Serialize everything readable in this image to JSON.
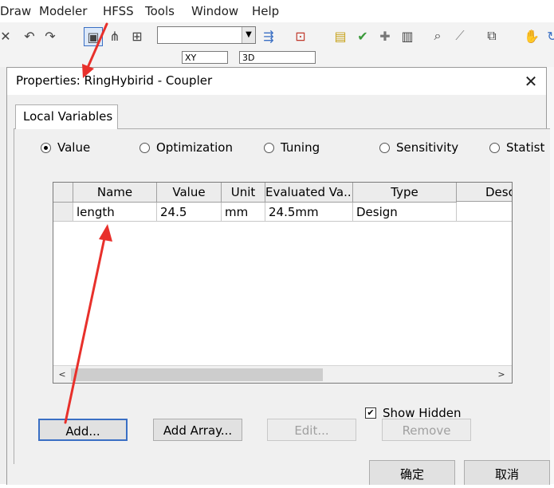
{
  "app": {
    "menu": [
      "Draw",
      "Modeler",
      "HFSS",
      "Tools",
      "Window",
      "Help"
    ],
    "toolbar_combo1": "",
    "toolbar_combo2": "XY",
    "toolbar_combo3": "3D"
  },
  "dialog": {
    "title": "Properties: RingHybirid - Coupler",
    "close": "✕",
    "tab": "Local Variables",
    "radios": [
      {
        "label": "Value",
        "selected": true
      },
      {
        "label": "Optimization",
        "selected": false
      },
      {
        "label": "Tuning",
        "selected": false
      },
      {
        "label": "Sensitivity",
        "selected": false
      },
      {
        "label": "Statist",
        "selected": false
      }
    ],
    "table": {
      "columns": [
        "Name",
        "Value",
        "Unit",
        "Evaluated Va...",
        "Type",
        "Desc"
      ],
      "rows": [
        [
          "length",
          "24.5",
          "mm",
          "24.5mm",
          "Design",
          ""
        ]
      ]
    },
    "show_hidden": {
      "label": "Show Hidden",
      "checked": true
    },
    "buttons": {
      "add": "Add...",
      "add_array": "Add Array...",
      "edit": "Edit...",
      "remove": "Remove"
    },
    "footer": {
      "ok": "确定",
      "cancel": "取消"
    }
  },
  "colors": {
    "arrow": "#e8302b",
    "dialog_bg": "#f0f0f0"
  }
}
